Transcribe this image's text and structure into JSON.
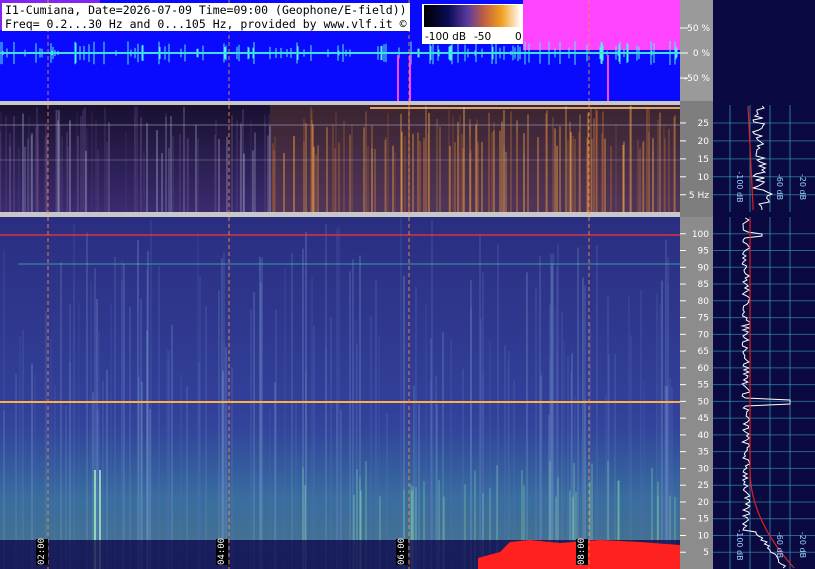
{
  "header": {
    "line1": "I1-Cumiana, Date=2026-07-09 Time=09:00 (Geophone/E-field))",
    "line2": "Freq= 0.2...30 Hz and 0...105 Hz, provided by www.vlf.it ©"
  },
  "colorbar": {
    "labels": [
      "-100 dB",
      "-50",
      "0"
    ]
  },
  "chart_data": [
    {
      "type": "line",
      "panel": "waveform",
      "ylabel_ticks": [
        "50 %",
        "0 %",
        "-50 %"
      ],
      "y_ticks": [
        50,
        0,
        -50
      ],
      "ylim": [
        -100,
        100
      ]
    },
    {
      "type": "heatmap",
      "panel": "low-frequency spectrogram",
      "y_ticks": [
        25,
        20,
        15,
        10,
        5
      ],
      "y_tick_labels": [
        "25",
        "20",
        "15",
        "10",
        "5 Hz"
      ],
      "ylim": [
        0.2,
        30
      ],
      "side_profile_labels": [
        "-100 dB",
        "-60 dB",
        "-20 dB"
      ]
    },
    {
      "type": "heatmap",
      "panel": "high-frequency spectrogram",
      "y_ticks": [
        100,
        95,
        90,
        85,
        80,
        75,
        70,
        65,
        60,
        55,
        50,
        45,
        40,
        35,
        30,
        25,
        20,
        15,
        10,
        5
      ],
      "ylim": [
        0,
        105
      ],
      "x_tick_labels": [
        "02:00",
        "04:00",
        "06:00",
        "08:00"
      ],
      "side_profile_labels": [
        "-100 dB",
        "-60 dB",
        "-20 dB"
      ]
    }
  ]
}
